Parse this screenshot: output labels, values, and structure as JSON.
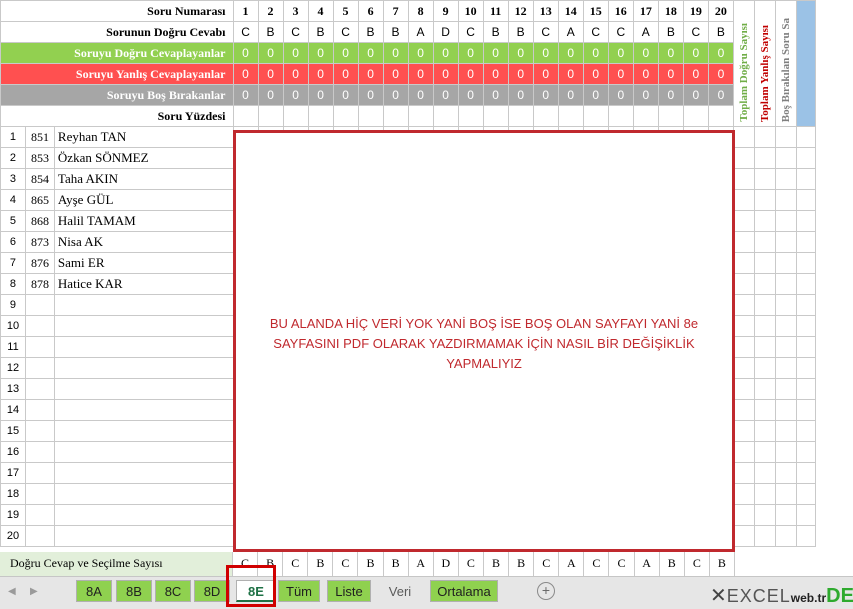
{
  "labels": {
    "soru_numarasi": "Soru Numarası",
    "dogru_cevap": "Sorunun Doğru Cevabı",
    "dogru_cevaplayanlar": "Soruyu Doğru Cevaplayanlar",
    "yanlis_cevaplayanlar": "Soruyu Yanlış Cevaplayanlar",
    "bos_birakanlar": "Soruyu Boş Bırakanlar",
    "soru_yuzdesi": "Soru Yüzdesi"
  },
  "questions": [
    "1",
    "2",
    "3",
    "4",
    "5",
    "6",
    "7",
    "8",
    "9",
    "10",
    "11",
    "12",
    "13",
    "14",
    "15",
    "16",
    "17",
    "18",
    "19",
    "20"
  ],
  "answers": [
    "C",
    "B",
    "C",
    "B",
    "C",
    "B",
    "B",
    "A",
    "D",
    "C",
    "B",
    "B",
    "C",
    "A",
    "C",
    "C",
    "A",
    "B",
    "C",
    "B"
  ],
  "zero": "0",
  "side_headers": {
    "toplam_dogru": "Toplam Doğru Sayısı",
    "toplam_yanlis": "Toplam Yanlış Sayısı",
    "bos_birakilan": "Boş Bırakılan Soru Sa"
  },
  "students": [
    {
      "row": "1",
      "no": "851",
      "name": "Reyhan TAN"
    },
    {
      "row": "2",
      "no": "853",
      "name": "Özkan SÖNMEZ"
    },
    {
      "row": "3",
      "no": "854",
      "name": "Taha AKIN"
    },
    {
      "row": "4",
      "no": "865",
      "name": "Ayşe GÜL"
    },
    {
      "row": "5",
      "no": "868",
      "name": "Halil TAMAM"
    },
    {
      "row": "6",
      "no": "873",
      "name": "Nisa AK"
    },
    {
      "row": "7",
      "no": "876",
      "name": "Sami ER"
    },
    {
      "row": "8",
      "no": "878",
      "name": "Hatice KAR"
    },
    {
      "row": "9",
      "no": "",
      "name": ""
    },
    {
      "row": "10",
      "no": "",
      "name": ""
    },
    {
      "row": "11",
      "no": "",
      "name": ""
    },
    {
      "row": "12",
      "no": "",
      "name": ""
    },
    {
      "row": "13",
      "no": "",
      "name": ""
    },
    {
      "row": "14",
      "no": "",
      "name": ""
    },
    {
      "row": "15",
      "no": "",
      "name": ""
    },
    {
      "row": "16",
      "no": "",
      "name": ""
    },
    {
      "row": "17",
      "no": "",
      "name": ""
    },
    {
      "row": "18",
      "no": "",
      "name": ""
    },
    {
      "row": "19",
      "no": "",
      "name": ""
    },
    {
      "row": "20",
      "no": "",
      "name": ""
    }
  ],
  "overlay_note": "BU ALANDA HİÇ VERİ YOK YANİ BOŞ İSE BOŞ OLAN SAYFAYI YANİ 8e SAYFASINI PDF OLARAK YAZDIRMAMAK İÇİN NASIL BİR DEĞİŞİKLİK YAPMALIYIZ",
  "bottom": {
    "label": "Doğru Cevap ve Seçilme Sayısı",
    "answers": [
      "C",
      "B",
      "C",
      "B",
      "C",
      "B",
      "B",
      "A",
      "D",
      "C",
      "B",
      "B",
      "C",
      "A",
      "C",
      "C",
      "A",
      "B",
      "C",
      "B"
    ]
  },
  "tabs": [
    {
      "label": "8A",
      "style": "green"
    },
    {
      "label": "8B",
      "style": "green"
    },
    {
      "label": "8C",
      "style": "green"
    },
    {
      "label": "8D",
      "style": "green"
    },
    {
      "label": "8E",
      "style": "active"
    },
    {
      "label": "Tüm",
      "style": "green"
    },
    {
      "label": "Liste",
      "style": "green"
    },
    {
      "label": "Veri",
      "style": "plain"
    },
    {
      "label": "Ortalama",
      "style": "green"
    }
  ],
  "nav": {
    "prev": "◀",
    "next": "▶",
    "add": "+"
  },
  "watermark": {
    "x": "✕",
    "text": "EXCEL",
    "small": "web.tr",
    "green": "DEPO"
  },
  "colors": {
    "green_row": "#92d050",
    "red_row": "#ff5050",
    "gray_row": "#a6a6a6",
    "highlight_border": "#c0292e",
    "active_tab_text": "#1e7145",
    "side_blue": "#9bc2e6"
  }
}
